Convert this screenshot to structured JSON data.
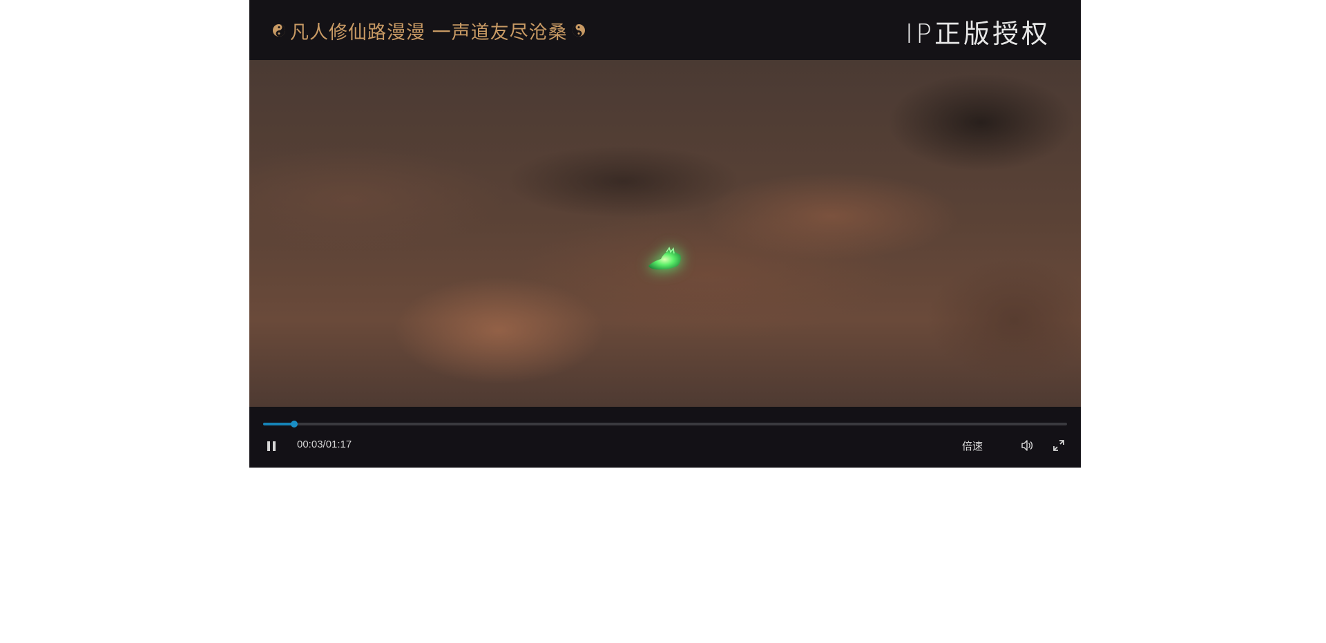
{
  "banner": {
    "left_text": "凡人修仙路漫漫  一声道友尽沧桑",
    "right_text": "IP正版授权",
    "icon_left": "yin-yang-icon",
    "icon_right": "yin-yang-icon"
  },
  "video": {
    "content": "video-frame"
  },
  "controls": {
    "progress_fraction": 0.039,
    "time_display": "00:03/01:17",
    "speed_label": "倍速",
    "play_state_icon": "pause-icon",
    "volume_icon": "volume-icon",
    "fullscreen_icon": "fullscreen-icon"
  },
  "colors": {
    "accent": "#1684b8",
    "banner_text": "#c89a64",
    "player_bg": "#131116"
  }
}
